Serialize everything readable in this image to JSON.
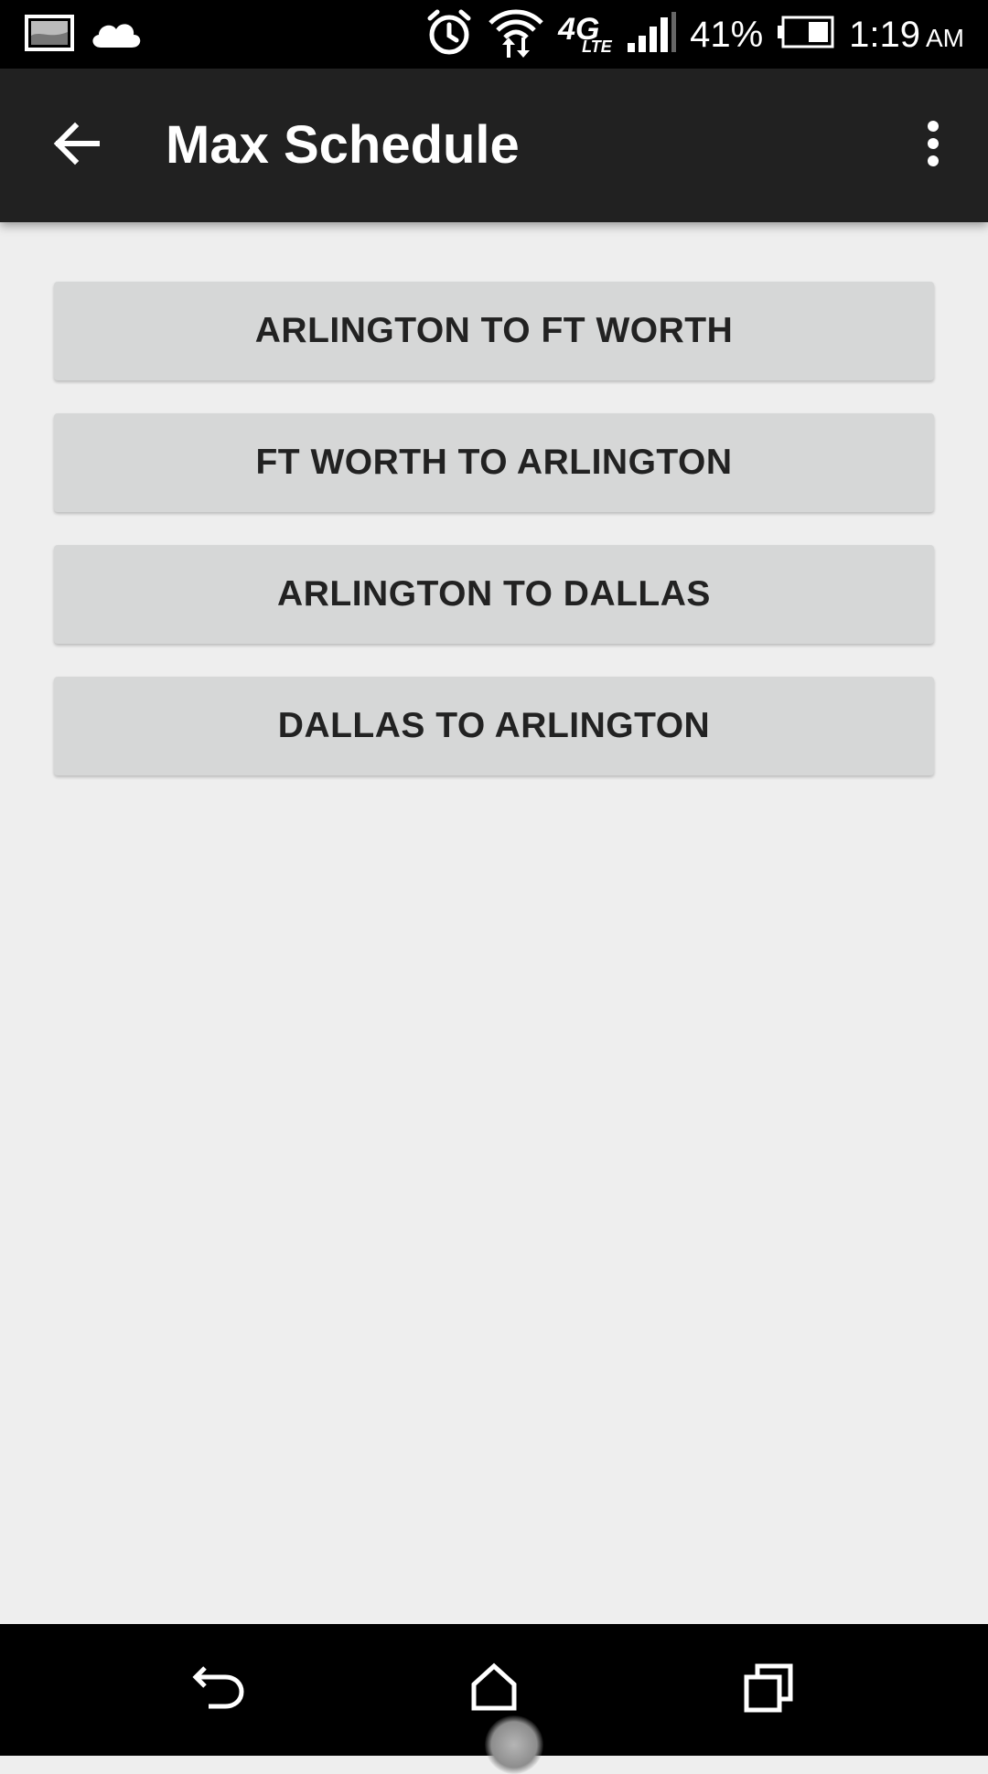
{
  "status_bar": {
    "battery_percent": "41%",
    "time": "1:19",
    "ampm": "AM",
    "network_main": "4G",
    "network_sub": "LTE",
    "icons": [
      "gallery-notification-icon",
      "cloud-icon",
      "alarm-icon",
      "wifi-icon",
      "signal-icon",
      "battery-icon"
    ]
  },
  "app_bar": {
    "title": "Max Schedule",
    "back_icon": "arrow-back-icon",
    "overflow_icon": "more-vert-icon"
  },
  "routes": [
    {
      "label": "ARLINGTON TO FT WORTH"
    },
    {
      "label": "FT WORTH TO ARLINGTON"
    },
    {
      "label": "ARLINGTON TO DALLAS"
    },
    {
      "label": "DALLAS TO ARLINGTON"
    }
  ],
  "nav_bar": {
    "icons": [
      "nav-back-icon",
      "nav-home-icon",
      "nav-recents-icon"
    ]
  },
  "colors": {
    "status_bar": "#000000",
    "app_bar": "#212121",
    "background": "#eeeeee",
    "button": "#d6d7d7",
    "button_text": "#222222"
  }
}
